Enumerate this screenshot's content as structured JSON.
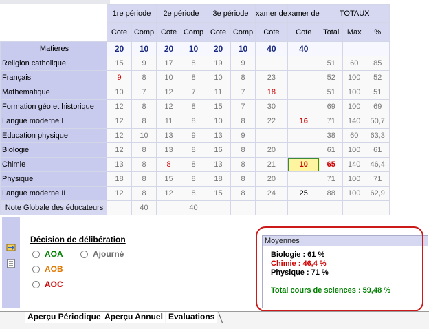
{
  "header": {
    "periods": [
      "1re période",
      "2e période",
      "3e période"
    ],
    "exam1": "xamer de",
    "exam2": "xamer de",
    "totaux": "TOTAUX",
    "sub": [
      "Cote",
      "Comp",
      "Cote",
      "Comp",
      "Cote",
      "Comp",
      "Cote",
      "Cote",
      "Total",
      "Max",
      "%"
    ]
  },
  "matieres": {
    "label": "Matieres",
    "values": [
      "20",
      "10",
      "20",
      "10",
      "20",
      "10",
      "40",
      "40",
      "",
      "",
      ""
    ]
  },
  "rows": [
    {
      "name": "Religion catholique",
      "cells": [
        "15",
        "9",
        "17",
        "8",
        "19",
        "9",
        "",
        "",
        "51",
        "60",
        "85"
      ]
    },
    {
      "name": "Français",
      "cells": [
        "9",
        "8",
        "10",
        "8",
        "10",
        "8",
        "23",
        "",
        "52",
        "100",
        "52"
      ]
    },
    {
      "name": "Mathématique",
      "cells": [
        "10",
        "7",
        "12",
        "7",
        "11",
        "7",
        "18",
        "",
        "51",
        "100",
        "51"
      ]
    },
    {
      "name": "Formation géo et historique",
      "cells": [
        "12",
        "8",
        "12",
        "8",
        "15",
        "7",
        "30",
        "",
        "69",
        "100",
        "69"
      ]
    },
    {
      "name": "Langue moderne I",
      "cells": [
        "12",
        "8",
        "11",
        "8",
        "10",
        "8",
        "22",
        "16",
        "71",
        "140",
        "50,7"
      ]
    },
    {
      "name": "Education physique",
      "cells": [
        "12",
        "10",
        "13",
        "9",
        "13",
        "9",
        "",
        "",
        "38",
        "60",
        "63,3"
      ]
    },
    {
      "name": "Biologie",
      "cells": [
        "12",
        "8",
        "13",
        "8",
        "16",
        "8",
        "20",
        "",
        "61",
        "100",
        "61"
      ]
    },
    {
      "name": "Chimie",
      "cells": [
        "13",
        "8",
        "8",
        "8",
        "13",
        "8",
        "21",
        "10",
        "65",
        "140",
        "46,4"
      ]
    },
    {
      "name": "Physique",
      "cells": [
        "18",
        "8",
        "15",
        "8",
        "18",
        "8",
        "20",
        "",
        "71",
        "100",
        "71"
      ]
    },
    {
      "name": "Langue moderne II",
      "cells": [
        "12",
        "8",
        "12",
        "8",
        "15",
        "8",
        "24",
        "25",
        "88",
        "100",
        "62,9"
      ]
    }
  ],
  "note_globale": {
    "label": "Note Globale des éducateurs",
    "cells": [
      "",
      "40",
      "",
      "40",
      "",
      "",
      "",
      "",
      "",
      "",
      ""
    ]
  },
  "decision": {
    "title": "Décision de délibération",
    "options": [
      "AOA",
      "AOB",
      "AOC",
      "Ajourné"
    ],
    "colors": {
      "AOA": "#008000",
      "AOB": "#e07800",
      "AOC": "#cc0000",
      "Ajourné": "#707070"
    }
  },
  "moyennes": {
    "title": "Moyennes",
    "biologie": "Biologie : 61 %",
    "chimie": "Chimie : 46,4 %",
    "physique": "Physique : 71 %",
    "total": "Total cours de sciences : 59,48 %"
  },
  "tabs": [
    "Aperçu Périodique",
    "Aperçu Annuel",
    "Evaluations"
  ]
}
